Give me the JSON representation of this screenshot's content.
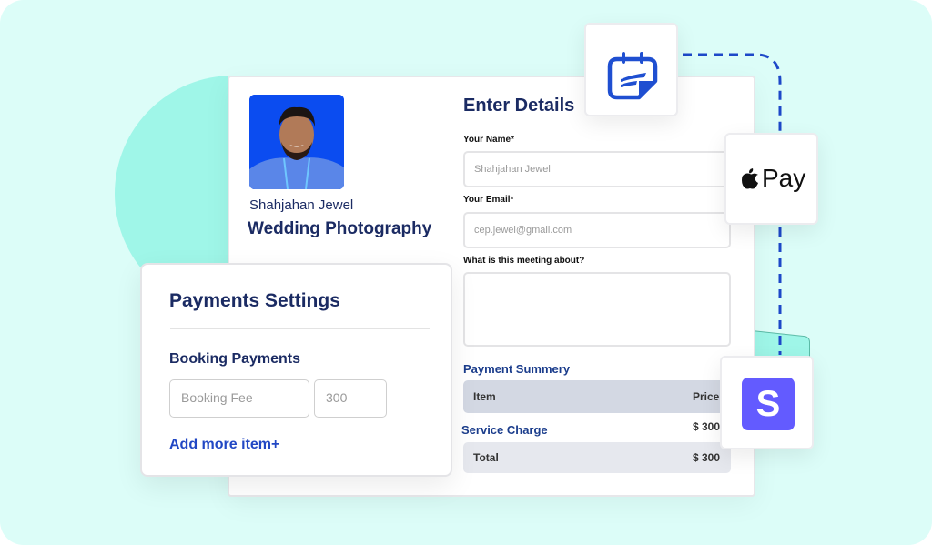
{
  "colors": {
    "background": "#dcfdf8",
    "accent_mint": "#9ff6e8",
    "navy": "#1b2b63",
    "link_blue": "#2147c4",
    "stripe_purple": "#635bff",
    "dash_blue": "#1d48c8"
  },
  "profile": {
    "host_name": "Shahjahan Jewel",
    "event_title": "Wedding Photography"
  },
  "form": {
    "title": "Enter Details",
    "name_label": "Your Name*",
    "name_value": "Shahjahan Jewel",
    "email_label": "Your Email*",
    "email_value": "cep.jewel@gmail.com",
    "about_label": "What is this meeting about?",
    "about_value": ""
  },
  "summary": {
    "title": "Payment Summery",
    "head_item": "Item",
    "head_price": "Price",
    "rows": [
      {
        "item": "Service Charge",
        "price": "$ 300"
      }
    ],
    "total_label": "Total",
    "total_value": "$ 300"
  },
  "payments_settings": {
    "title": "Payments Settings",
    "section": "Booking Payments",
    "fee_name_placeholder": "Booking Fee",
    "fee_amount": "300",
    "add_more": "Add more item+"
  },
  "integrations": {
    "fluent_icon": "calendar-form-icon",
    "apple_pay_label": "Pay",
    "stripe_letter": "S"
  }
}
